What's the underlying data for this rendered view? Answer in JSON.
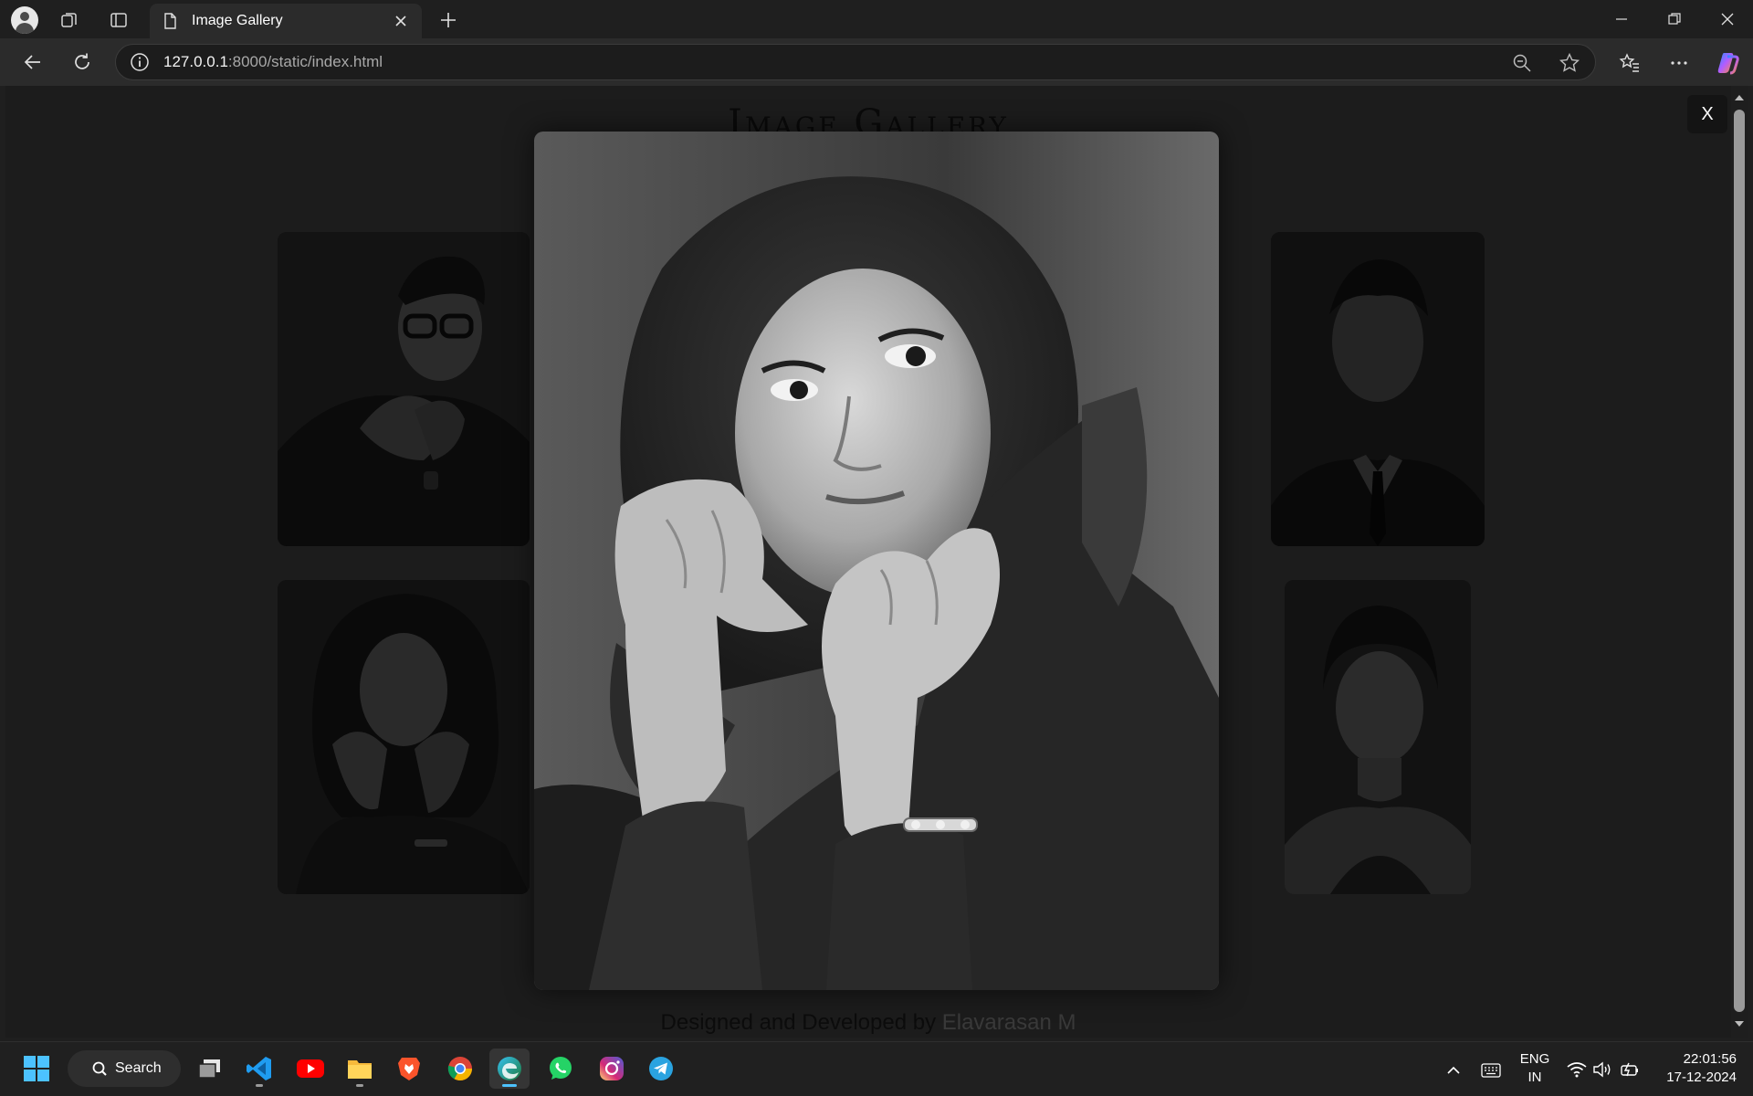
{
  "browser": {
    "tab_title": "Image Gallery",
    "url_host": "127.0.0.1",
    "url_rest": ":8000/static/index.html"
  },
  "page": {
    "title": "Image Gallery",
    "footer_prefix": "Designed and Developed by ",
    "footer_author": "Elavarasan M",
    "modal_close_label": "X"
  },
  "taskbar": {
    "search_label": "Search",
    "apps": [
      "start-icon",
      "task-view-icon",
      "vscode-icon",
      "youtube-icon",
      "file-explorer-icon",
      "brave-icon",
      "chrome-icon",
      "edge-icon",
      "whatsapp-icon",
      "instagram-icon",
      "telegram-icon"
    ]
  },
  "tray": {
    "lang_line1": "ENG",
    "lang_line2": "IN",
    "time": "22:01:56",
    "date": "17-12-2024"
  },
  "colors": {
    "accent": "#4cc2ff",
    "page_bg": "#1e1e1e"
  }
}
